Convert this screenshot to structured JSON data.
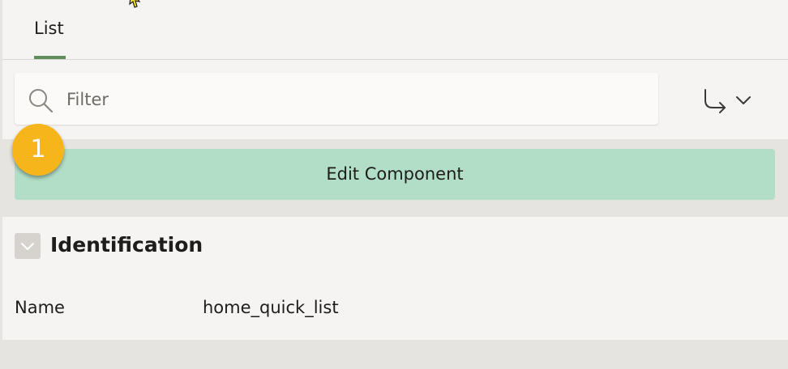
{
  "tabs": [
    {
      "label": "List",
      "active": true
    }
  ],
  "filter": {
    "placeholder": "Filter",
    "value": ""
  },
  "toolbar": {
    "goto_icon": "goto-arrow-icon",
    "menu_icon": "chevron-down-icon"
  },
  "callout": {
    "number": "1",
    "color": "#f6b51a"
  },
  "edit_button": {
    "label": "Edit Component",
    "color": "#b2dec7"
  },
  "section": {
    "title": "Identification",
    "expanded": true
  },
  "properties": [
    {
      "label": "Name",
      "value": "home_quick_list"
    }
  ],
  "colors": {
    "tab_active_underline": "#5f8d5b",
    "panel_background": "#f5f4f2",
    "page_background": "#e6e4e1"
  }
}
